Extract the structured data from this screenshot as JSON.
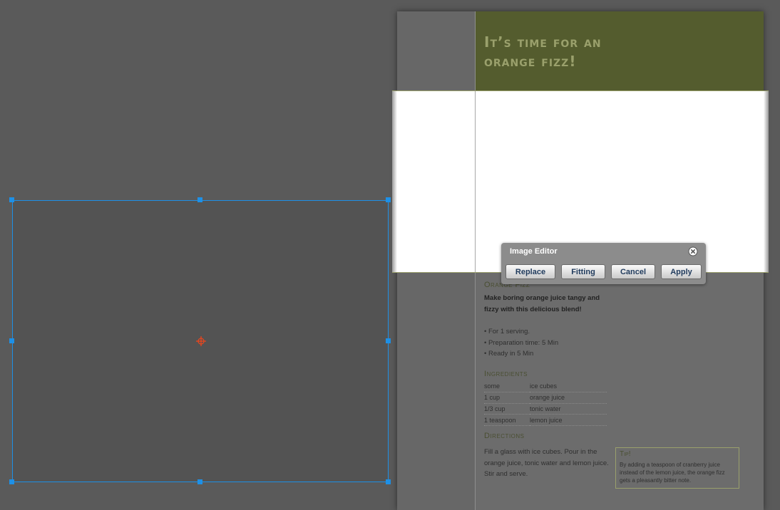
{
  "document": {
    "title_line1": "It’s time for an",
    "title_line2": "orange fizz!",
    "recipe_heading": "Orange Fizz",
    "intro": "Make boring orange juice tangy and fizzy with this delicious blend!",
    "bullets": [
      "• For 1 serving.",
      "• Preparation time: 5 Min",
      "• Ready in 5 Min"
    ],
    "ingredients_heading": "Ingredients",
    "ingredients": [
      {
        "amount": "some",
        "item": "ice cubes"
      },
      {
        "amount": "1 cup",
        "item": "orange juice"
      },
      {
        "amount": "1/3 cup",
        "item": "tonic water"
      },
      {
        "amount": "1 teaspoon",
        "item": "lemon juice"
      }
    ],
    "directions_heading": "Directions",
    "directions": "Fill a glass with ice cubes. Pour in the orange juice, tonic water and lemon juice. Stir and serve.",
    "tip_heading": "Tip!",
    "tip_body": "By adding a teaspoon of cranberry juice instead of the lemon juice, the orange fizz gets a pleasantly bitter note."
  },
  "image_editor": {
    "title": "Image Editor",
    "buttons": {
      "replace": "Replace",
      "fitting": "Fitting",
      "cancel": "Cancel",
      "apply": "Apply"
    }
  },
  "icons": {
    "close": "close-icon",
    "crosshair": "crosshair-icon"
  },
  "colors": {
    "selection": "#1e90e6",
    "crosshair": "#e8461e",
    "header_bg": "#545c2e",
    "title_text": "#9aa06c"
  }
}
